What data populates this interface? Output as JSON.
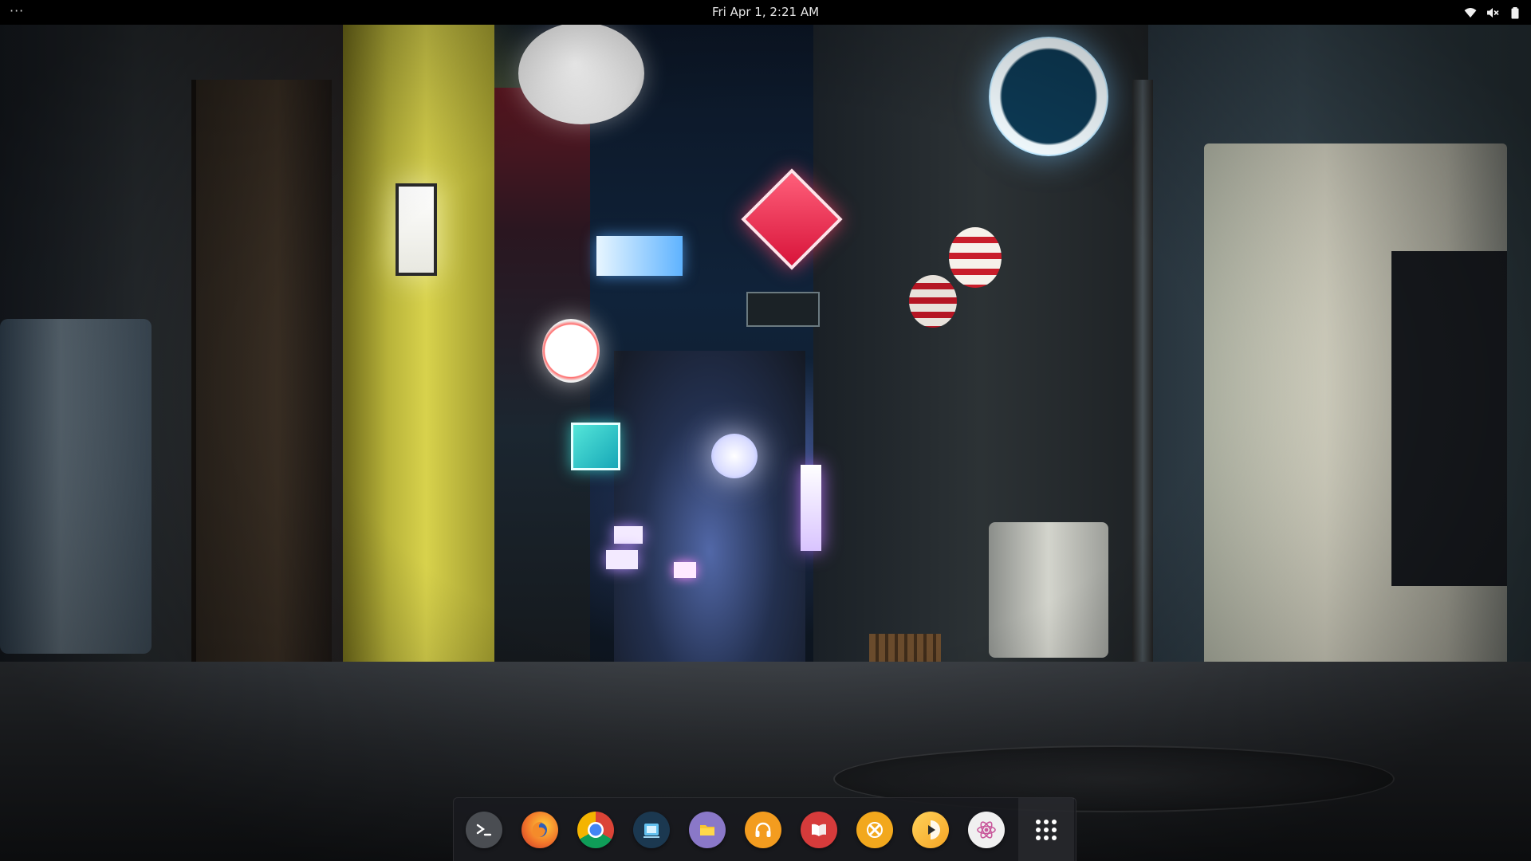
{
  "top_panel": {
    "activities_label": "···",
    "clock": "Fri Apr  1,  2:21 AM",
    "status_icons": [
      "wifi-icon",
      "volume-muted-icon",
      "battery-icon"
    ]
  },
  "dock": {
    "apps": [
      {
        "name": "terminal",
        "icon": "terminal-icon",
        "color": "#4a4d52"
      },
      {
        "name": "firefox",
        "icon": "firefox-icon",
        "color": "#e8602c"
      },
      {
        "name": "chrome",
        "icon": "chrome-icon",
        "color": "#db4437"
      },
      {
        "name": "screenshot",
        "icon": "screenshot-icon",
        "color": "#1f6fa0"
      },
      {
        "name": "files",
        "icon": "folder-icon",
        "color": "#8a78c8"
      },
      {
        "name": "music",
        "icon": "headphones-icon",
        "color": "#f39c1f"
      },
      {
        "name": "book-reader",
        "icon": "book-icon",
        "color": "#d63b3b"
      },
      {
        "name": "tools",
        "icon": "tools-icon",
        "color": "#f2a81d"
      },
      {
        "name": "video-player",
        "icon": "play-icon",
        "color": "#f5b82e"
      },
      {
        "name": "atom",
        "icon": "atom-icon",
        "color": "#f0f0f0"
      }
    ],
    "show_apps_icon": "app-grid-icon"
  },
  "wallpaper": {
    "description_icon": "wallpaper-image"
  }
}
